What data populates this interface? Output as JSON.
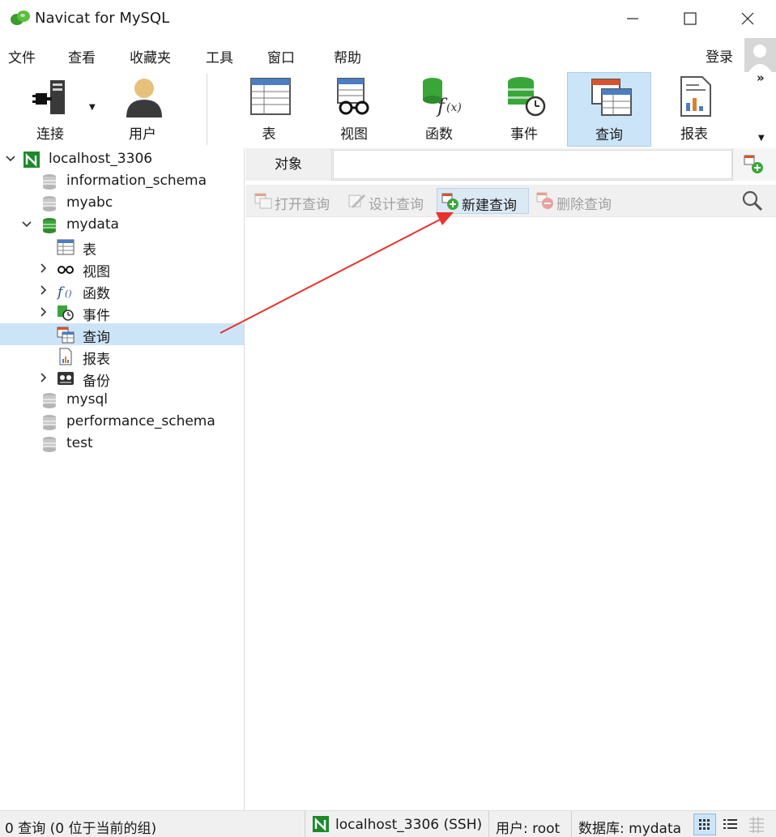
{
  "window": {
    "title": "Navicat for MySQL"
  },
  "menu": {
    "items": [
      "文件",
      "查看",
      "收藏夹",
      "工具",
      "窗口",
      "帮助"
    ],
    "login": "登录"
  },
  "toolbar": {
    "buttons": [
      {
        "label": "连接",
        "icon": "plug-icon"
      },
      {
        "label": "用户",
        "icon": "user-icon"
      },
      {
        "label": "表",
        "icon": "table-icon"
      },
      {
        "label": "视图",
        "icon": "view-icon"
      },
      {
        "label": "函数",
        "icon": "function-icon"
      },
      {
        "label": "事件",
        "icon": "event-icon"
      },
      {
        "label": "查询",
        "icon": "query-icon",
        "active": true
      },
      {
        "label": "报表",
        "icon": "report-icon"
      }
    ],
    "more": "»"
  },
  "tree": {
    "connection": "localhost_3306",
    "databases": {
      "information_schema": "information_schema",
      "myabc": "myabc",
      "mydata": "mydata",
      "mysql": "mysql",
      "performance_schema": "performance_schema",
      "test": "test"
    },
    "mydata_children": {
      "tables": "表",
      "views": "视图",
      "functions": "函数",
      "events": "事件",
      "queries": "查询",
      "reports": "报表",
      "backups": "备份"
    }
  },
  "main": {
    "tab": "对象",
    "actions": {
      "open": "打开查询",
      "design": "设计查询",
      "new": "新建查询",
      "delete": "删除查询"
    }
  },
  "status": {
    "count": "0 查询 (0 位于当前的组)",
    "connection": "localhost_3306 (SSH)",
    "user": "用户: root",
    "database": "数据库: mydata"
  },
  "colors": {
    "accent": "#cce4f7",
    "mysql_green": "#3aa63a",
    "annotation_red": "#e8322d"
  }
}
